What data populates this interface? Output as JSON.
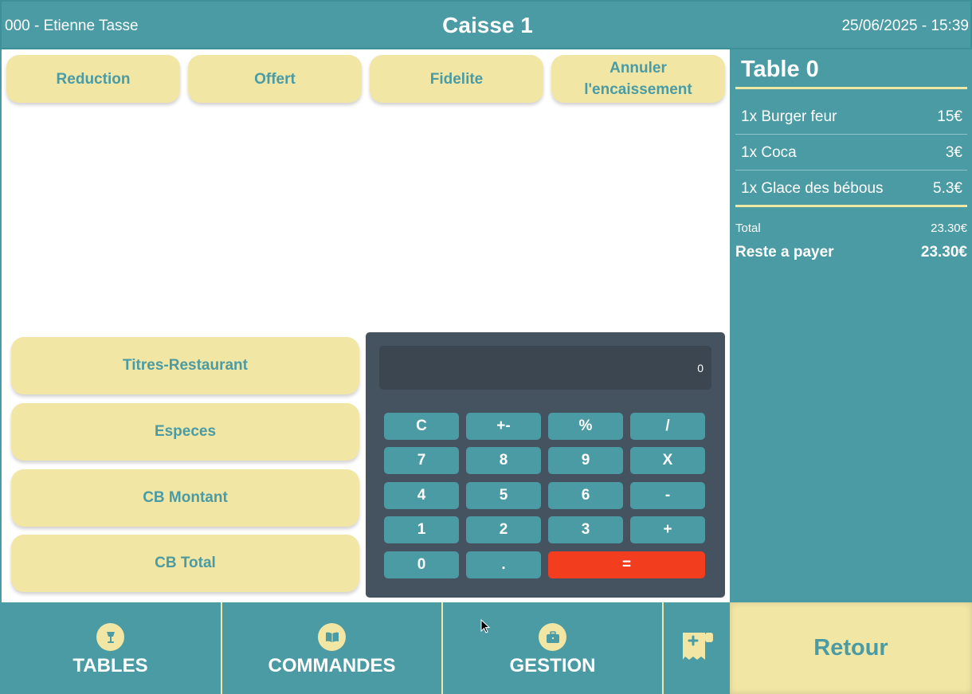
{
  "header": {
    "user": "000 - Etienne Tasse",
    "title": "Caisse 1",
    "datetime": "25/06/2025 - 15:39"
  },
  "actions": {
    "reduction": "Reduction",
    "offert": "Offert",
    "fidelite": "Fidelite",
    "annuler_line1": "Annuler",
    "annuler_line2": "l'encaissement"
  },
  "payments": {
    "titres": "Titres-Restaurant",
    "especes": "Especes",
    "cb_montant": "CB Montant",
    "cb_total": "CB Total"
  },
  "calculator": {
    "display": "0",
    "keys": [
      "C",
      "+-",
      "%",
      "/",
      "7",
      "8",
      "9",
      "X",
      "4",
      "5",
      "6",
      "-",
      "1",
      "2",
      "3",
      "+",
      "0",
      ".",
      "="
    ]
  },
  "order": {
    "table": "Table 0",
    "items": [
      {
        "name": "1x Burger feur",
        "price": "15€"
      },
      {
        "name": "1x Coca",
        "price": "3€"
      },
      {
        "name": "1x Glace des bébous",
        "price": "5.3€"
      }
    ],
    "total_label": "Total",
    "total_value": "23.30€",
    "due_label": "Reste a payer",
    "due_value": "23.30€"
  },
  "nav": {
    "tables": "TABLES",
    "commandes": "COMMANDES",
    "gestion": "GESTION",
    "retour": "Retour"
  },
  "colors": {
    "teal": "#4a9ba4",
    "cream": "#f2e6a4",
    "calc_bg": "#455260",
    "equals": "#f23d1e"
  }
}
